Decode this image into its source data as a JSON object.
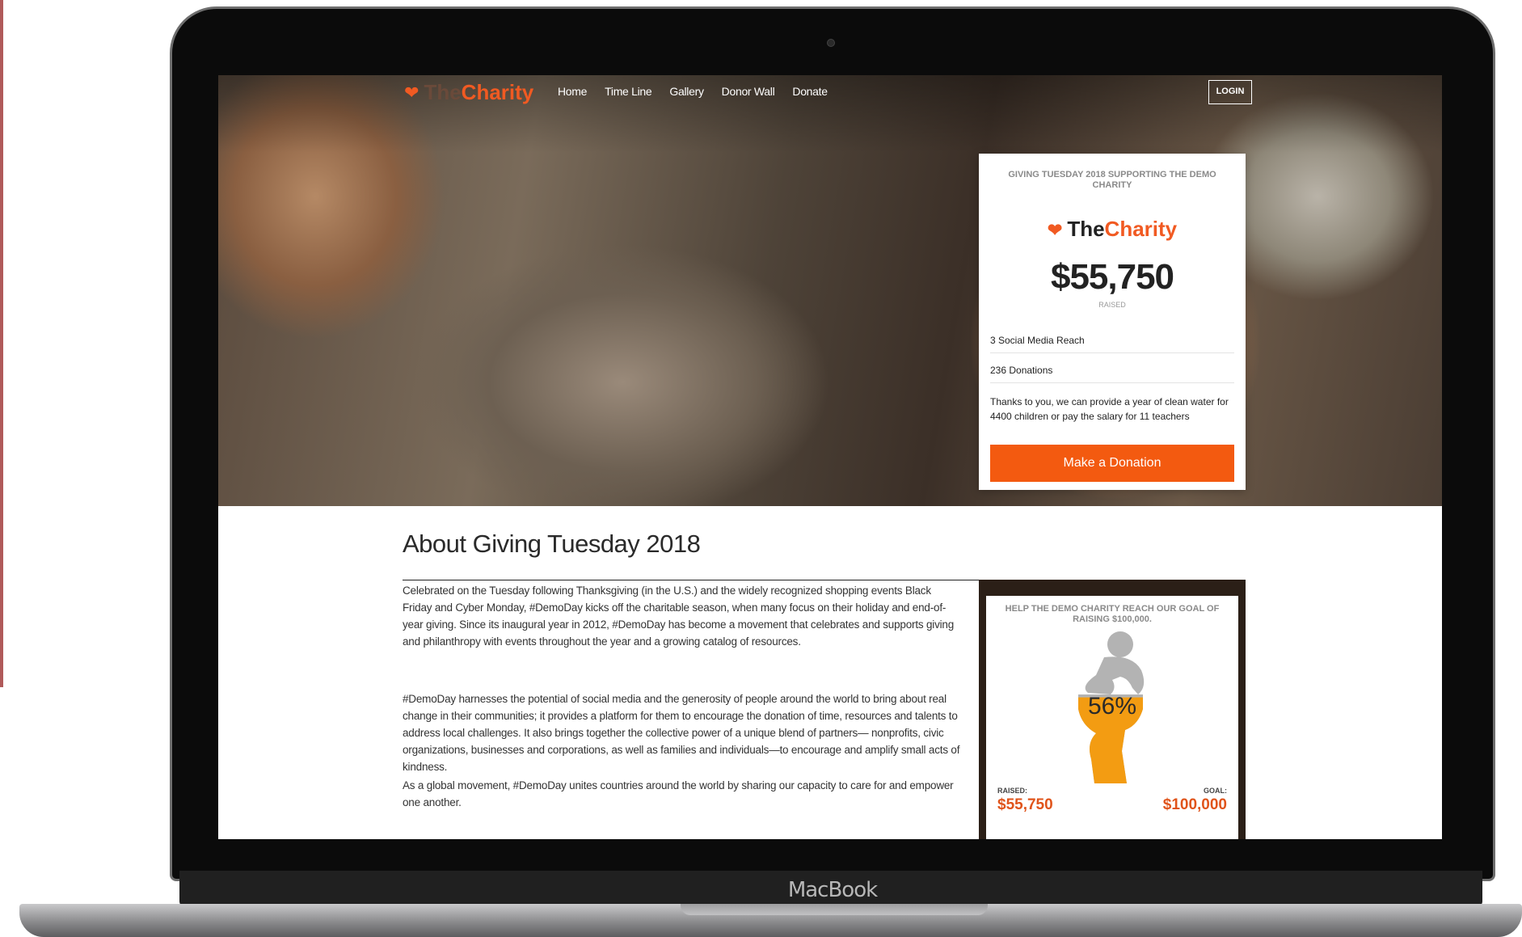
{
  "device": {
    "brand": "MacBook"
  },
  "nav": {
    "logo_the": "The",
    "logo_charity": "Charity",
    "links": [
      "Home",
      "Time Line",
      "Gallery",
      "Donor Wall",
      "Donate"
    ],
    "login": "LOGIN"
  },
  "card": {
    "title": "GIVING TUESDAY 2018 SUPPORTING THE DEMO CHARITY",
    "logo_the": "The",
    "logo_charity": "Charity",
    "amount": "$55,750",
    "amount_label": "RAISED",
    "stats": [
      "3 Social Media Reach",
      "236 Donations",
      "Thanks to you, we can provide a year of clean water for 4400 children or pay the salary for 11 teachers"
    ],
    "button": "Make a Donation"
  },
  "about": {
    "title": "About Giving Tuesday 2018",
    "paragraphs": [
      "Celebrated on the Tuesday following Thanksgiving (in the U.S.) and the widely recognized shopping events Black Friday and Cyber Monday, #DemoDay kicks off the charitable season, when many focus on their holiday and end-of-year giving. Since its inaugural year in 2012, #DemoDay has become a movement that celebrates and supports giving and philanthropy with events throughout the year and a growing catalog of resources.",
      "#DemoDay harnesses the potential of social media and the generosity of people around the world to bring about real change in their communities; it provides a platform for them to encourage the donation of time, resources and talents to address local challenges. It also brings together the collective power of a unique blend of partners— nonprofits, civic organizations, businesses and corporations, as well as families and individuals—to encourage and amplify small acts of kindness.",
      "As a global movement, #DemoDay unites countries around the world by sharing our capacity to care for and empower one another."
    ]
  },
  "goal": {
    "title": "HELP THE DEMO CHARITY REACH OUR GOAL OF RAISING $100,000.",
    "percent_label": "56%",
    "progress_fraction": 0.56,
    "raised_label": "RAISED:",
    "raised": "$55,750",
    "goal_label": "GOAL:",
    "goal": "$100,000",
    "fill_color": "#f39c12"
  },
  "colors": {
    "accent": "#f15a22",
    "button": "#f35a10"
  }
}
